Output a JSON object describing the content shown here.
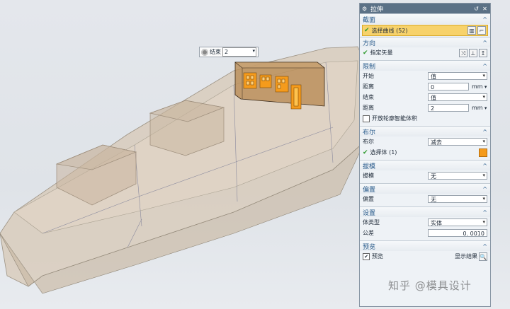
{
  "mini_toolbar": {
    "label": "结束",
    "value": "2"
  },
  "dialog": {
    "title": "拉伸",
    "sections": {
      "section": {
        "title": "截面",
        "select_curve": "选择曲线 (52)"
      },
      "direction": {
        "title": "方向",
        "specify_vector": "指定矢量"
      },
      "limits": {
        "title": "限制",
        "start_label": "开始",
        "start_value": "值",
        "distance1_label": "距离",
        "distance1_value": "0",
        "distance1_unit": "mm",
        "end_label": "结束",
        "end_value": "值",
        "distance2_label": "距离",
        "distance2_value": "2",
        "distance2_unit": "mm",
        "open_profile": "开放轮廓智能体积"
      },
      "boolean": {
        "title": "布尔",
        "boolean_label": "布尔",
        "boolean_value": "减去",
        "select_body": "选择体 (1)"
      },
      "draft": {
        "title": "拔模",
        "draft_label": "拔模",
        "draft_value": "无"
      },
      "offset": {
        "title": "偏置",
        "offset_label": "偏置",
        "offset_value": "无"
      },
      "settings": {
        "title": "设置",
        "body_type_label": "体类型",
        "body_type_value": "实体",
        "tolerance_label": "公差",
        "tolerance_value": "0. 0010"
      },
      "preview": {
        "title": "预览",
        "preview_label": "预览",
        "show_result": "显示结果"
      }
    }
  },
  "watermark": "知乎 @模具设计",
  "colors": {
    "titlebar": "#5b7186",
    "highlight": "#f7d26b",
    "accent_orange": "#f59b1c",
    "section_title": "#2a5c8c"
  }
}
